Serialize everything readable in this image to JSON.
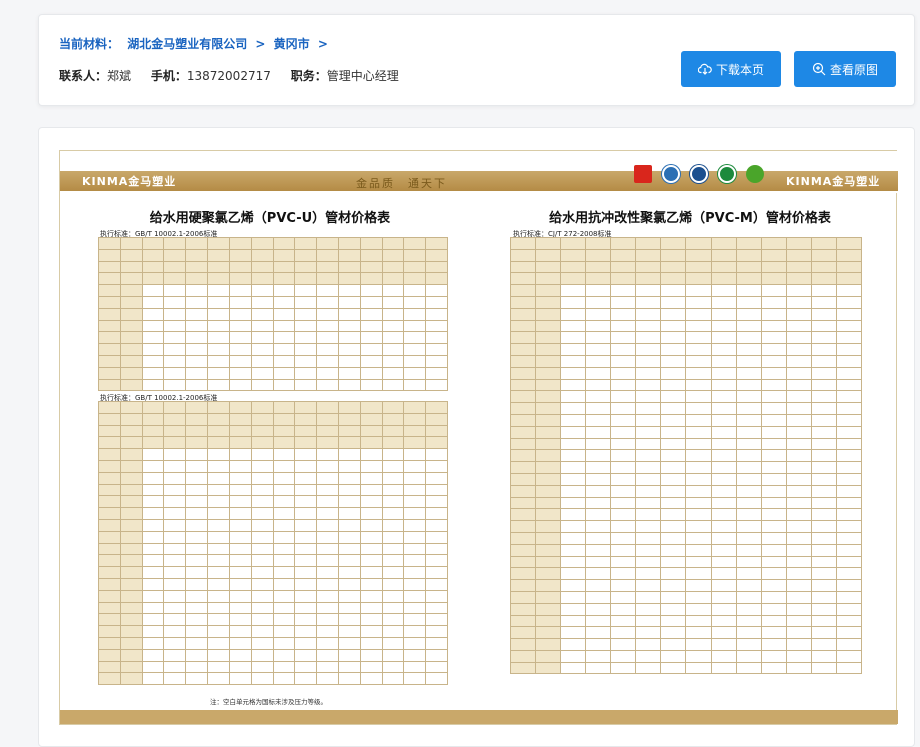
{
  "header": {
    "label": "当前材料：",
    "company": "湖北金马塑业有限公司",
    "sep1": ">",
    "city": "黄冈市",
    "sep2": ">",
    "contact_label": "联系人：",
    "contact": "郑斌",
    "phone_label": "手机：",
    "phone": "13872002717",
    "role_label": "职务：",
    "role": "管理中心经理"
  },
  "buttons": {
    "download": "下载本页",
    "view": "查看原图"
  },
  "sheet": {
    "brand": "KINMA金马塑业",
    "slogan": "金品质　通天下",
    "left": {
      "title": "给水用硬聚氯乙烯（PVC-U）管材价格表",
      "std1": "执行标准：GB/T 10002.1-2006标准",
      "std2": "执行标准：GB/T 10002.1-2006标准"
    },
    "right": {
      "title": "给水用抗冲改性聚氯乙烯（PVC-M）管材价格表",
      "std": "执行标准：CJ/T 272-2008标准"
    },
    "note": "注：空白单元格为国标未涉及压力等级。",
    "colors": {
      "gold": "#c9a86a",
      "accent": "#1e88e5"
    }
  }
}
